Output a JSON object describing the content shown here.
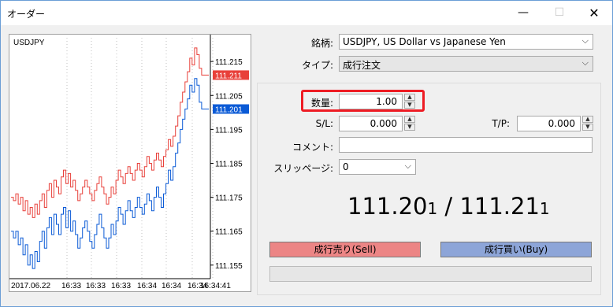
{
  "window": {
    "title": "オーダー",
    "minimize": "—",
    "maximize": "☐",
    "close": "✕"
  },
  "chart": {
    "symbol": "USDJPY",
    "y_ticks": [
      "111.215",
      "111.205",
      "111.195",
      "111.185",
      "111.175",
      "111.165",
      "111.155"
    ],
    "x_ticks": [
      "2017.06.22",
      "16:33",
      "16:33",
      "16:33",
      "16:34",
      "16:34",
      "16:34",
      "16:34:41"
    ],
    "ask_label": "111.211",
    "bid_label": "111.201",
    "ask_color": "#e8403a",
    "bid_color": "#0a5ad6"
  },
  "chart_data": {
    "type": "line",
    "title": "USDJPY",
    "ylim": [
      111.151,
      111.222
    ],
    "y_ticks": [
      111.215,
      111.205,
      111.195,
      111.185,
      111.175,
      111.165,
      111.155
    ],
    "series": [
      {
        "values": [
          111.175,
          111.174,
          111.176,
          111.173,
          111.175,
          111.171,
          111.174,
          111.17,
          111.172,
          111.169,
          111.173,
          111.17,
          111.174,
          111.176,
          111.172,
          111.177,
          111.179,
          111.175,
          111.18,
          111.178,
          111.176,
          111.181,
          111.183,
          111.179,
          111.182,
          111.178,
          111.18,
          111.177,
          111.174,
          111.176,
          111.178,
          111.18,
          111.178,
          111.176,
          111.174,
          111.177,
          111.179,
          111.181,
          111.178,
          111.176,
          111.173,
          111.175,
          111.178,
          111.176,
          111.18,
          111.183,
          111.181,
          111.179,
          111.182,
          111.184,
          111.182,
          111.18,
          111.183,
          111.185,
          111.183,
          111.181,
          111.184,
          111.187,
          111.185,
          111.183,
          111.186,
          111.188,
          111.186,
          111.184,
          111.187,
          111.189,
          111.192,
          111.19,
          111.193,
          111.196,
          111.199,
          111.203,
          111.206,
          111.209,
          111.212,
          111.216,
          111.214,
          111.219,
          111.217,
          111.213,
          111.211,
          111.211,
          111.211,
          111.211
        ]
      },
      {
        "values": [
          111.165,
          111.163,
          111.165,
          111.161,
          111.163,
          111.158,
          111.161,
          111.155,
          111.158,
          111.154,
          111.159,
          111.156,
          111.162,
          111.165,
          111.16,
          111.166,
          111.169,
          111.164,
          111.17,
          111.167,
          111.164,
          111.17,
          111.172,
          111.166,
          111.171,
          111.165,
          111.168,
          111.164,
          111.16,
          111.163,
          111.166,
          111.168,
          111.165,
          111.162,
          111.16,
          111.164,
          111.167,
          111.17,
          111.166,
          111.163,
          111.16,
          111.163,
          111.167,
          111.164,
          111.168,
          111.172,
          111.17,
          111.167,
          111.171,
          111.174,
          111.171,
          111.169,
          111.172,
          111.175,
          111.172,
          111.17,
          111.173,
          111.176,
          111.174,
          111.171,
          111.175,
          111.178,
          111.175,
          111.172,
          111.176,
          111.179,
          111.183,
          111.18,
          111.184,
          111.188,
          111.191,
          111.195,
          111.198,
          111.201,
          111.204,
          111.208,
          111.206,
          111.21,
          111.208,
          111.203,
          111.201,
          111.201,
          111.201,
          111.201
        ]
      }
    ]
  },
  "form": {
    "symbol_label": "銘柄:",
    "symbol_value": "USDJPY, US Dollar vs Japanese Yen",
    "type_label": "タイプ:",
    "type_value": "成行注文",
    "volume_label": "数量:",
    "volume_value": "1.00",
    "sl_label": "S/L:",
    "sl_value": "0.000",
    "tp_label": "T/P:",
    "tp_value": "0.000",
    "comment_label": "コメント:",
    "comment_value": "",
    "slippage_label": "スリッページ:",
    "slippage_value": "0",
    "price_bid_main": "111.20",
    "price_bid_sub": "1",
    "price_sep": " / ",
    "price_ask_main": "111.21",
    "price_ask_sub": "1",
    "sell_label": "成行売り(Sell)",
    "buy_label": "成行買い(Buy)"
  },
  "icons": {
    "dropdown": "chevron-down-icon",
    "spin_up": "▲",
    "spin_down": "▼",
    "arrow": "⌵"
  },
  "colors": {
    "sell_button": "#ec8585",
    "buy_button": "#8da5d8",
    "highlight": "#ee1c24"
  }
}
